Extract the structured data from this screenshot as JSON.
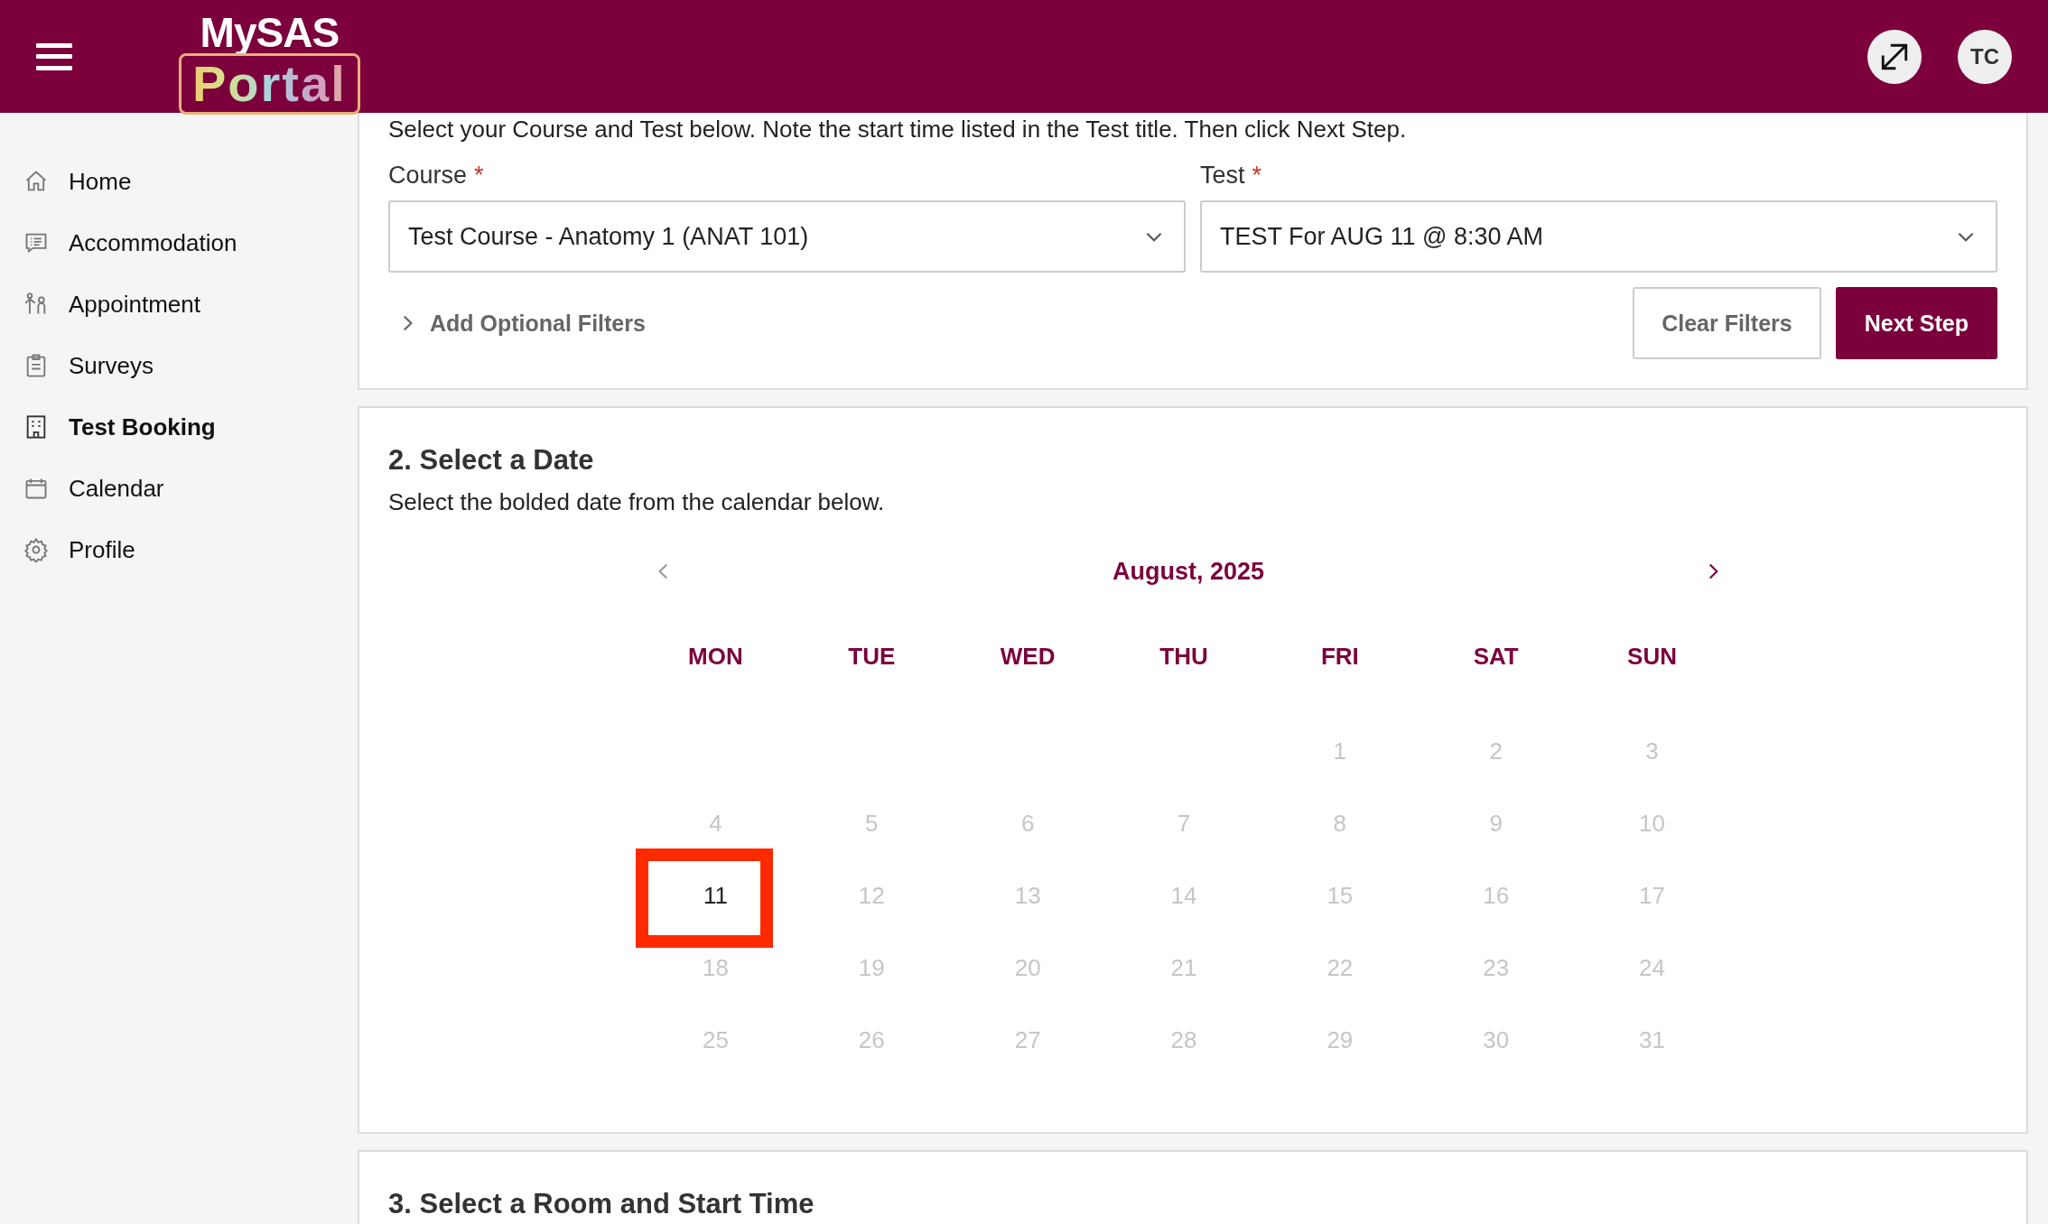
{
  "header": {
    "logo_top": "MySAS",
    "logo_bottom": "Portal",
    "avatar": "TC"
  },
  "sidebar": {
    "items": [
      {
        "label": "Home",
        "selected": false
      },
      {
        "label": "Accommodation",
        "selected": false
      },
      {
        "label": "Appointment",
        "selected": false
      },
      {
        "label": "Surveys",
        "selected": false
      },
      {
        "label": "Test Booking",
        "selected": true
      },
      {
        "label": "Calendar",
        "selected": false
      },
      {
        "label": "Profile",
        "selected": false
      }
    ]
  },
  "step1": {
    "instructions": "Select your Course and Test below. Note the start time listed in the Test title. Then click Next Step.",
    "fields": [
      {
        "label": "Course",
        "required_mark": "*",
        "value": "Test Course - Anatomy 1 (ANAT 101)"
      },
      {
        "label": "Test",
        "required_mark": "*",
        "value": "TEST For AUG 11 @ 8:30 AM"
      }
    ],
    "filters_toggle": "Add Optional Filters",
    "clear_button": "Clear Filters",
    "next_button": "Next Step"
  },
  "step2": {
    "title": "2. Select a Date",
    "instructions": "Select the bolded date from the calendar below.",
    "month": "August, 2025",
    "weekdays": [
      "MON",
      "TUE",
      "WED",
      "THU",
      "FRI",
      "SAT",
      "SUN"
    ],
    "weeks": [
      [
        {
          "day": "1",
          "available": false
        },
        {
          "day": "2",
          "available": false
        },
        {
          "day": "3",
          "available": false
        }
      ],
      [
        {
          "day": "4",
          "available": false
        },
        {
          "day": "5",
          "available": false
        },
        {
          "day": "6",
          "available": false
        },
        {
          "day": "7",
          "available": false
        },
        {
          "day": "8",
          "available": false
        },
        {
          "day": "9",
          "available": false
        },
        {
          "day": "10",
          "available": false
        }
      ],
      [
        {
          "day": "11",
          "available": true,
          "highlighted": true
        },
        {
          "day": "12",
          "available": false
        },
        {
          "day": "13",
          "available": false
        },
        {
          "day": "14",
          "available": false
        },
        {
          "day": "15",
          "available": false
        },
        {
          "day": "16",
          "available": false
        },
        {
          "day": "17",
          "available": false
        }
      ],
      [
        {
          "day": "18",
          "available": false
        },
        {
          "day": "19",
          "available": false
        },
        {
          "day": "20",
          "available": false
        },
        {
          "day": "21",
          "available": false
        },
        {
          "day": "22",
          "available": false
        },
        {
          "day": "23",
          "available": false
        },
        {
          "day": "24",
          "available": false
        }
      ],
      [
        {
          "day": "25",
          "available": false
        },
        {
          "day": "26",
          "available": false
        },
        {
          "day": "27",
          "available": false
        },
        {
          "day": "28",
          "available": false
        },
        {
          "day": "29",
          "available": false
        },
        {
          "day": "30",
          "available": false
        },
        {
          "day": "31",
          "available": false
        }
      ]
    ]
  },
  "step3": {
    "title": "3. Select a Room and Start Time"
  }
}
